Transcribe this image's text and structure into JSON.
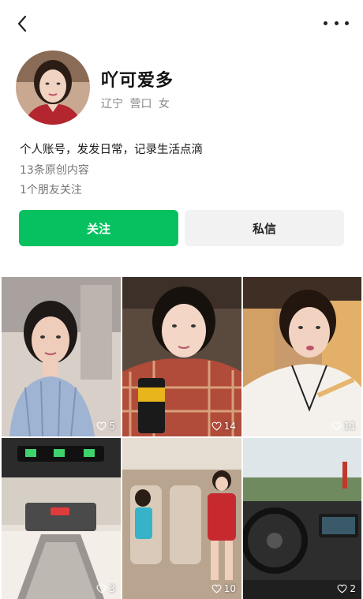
{
  "header": {
    "back_icon": "chevron-left-icon",
    "more_icon": "more-dots-icon"
  },
  "profile": {
    "name": "吖可爱多",
    "province": "辽宁",
    "city": "营口",
    "gender": "女",
    "bio": "个人账号，发发日常，记录生活点滴",
    "posts_count": "13条原创内容",
    "friends_follow": "1个朋友关注"
  },
  "actions": {
    "follow_label": "关注",
    "message_label": "私信",
    "follow_color": "#07c160"
  },
  "posts": [
    {
      "likes": "5"
    },
    {
      "likes": "14"
    },
    {
      "likes": "11"
    },
    {
      "likes": "3"
    },
    {
      "likes": "10"
    },
    {
      "likes": "2"
    }
  ]
}
